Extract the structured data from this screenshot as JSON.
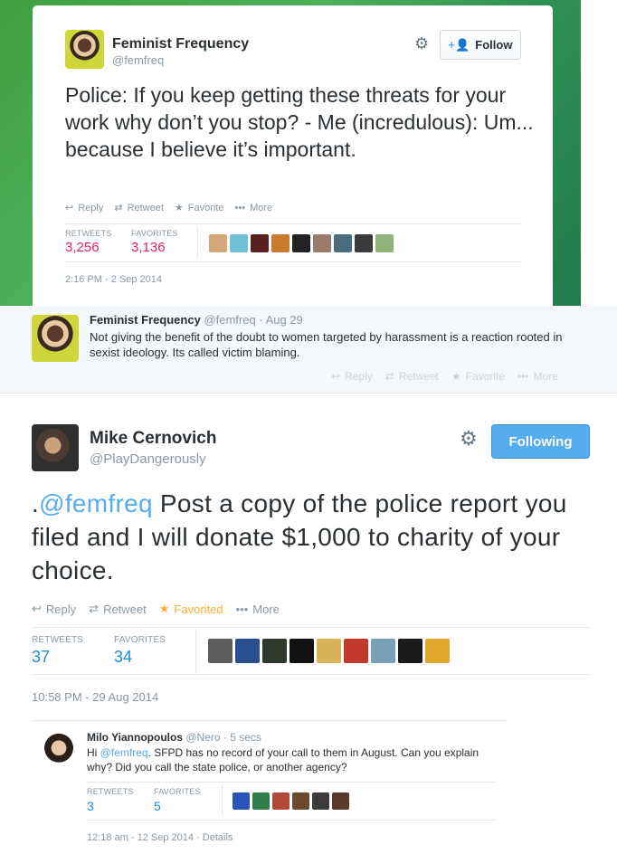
{
  "tweet1": {
    "name": "Feminist Frequency",
    "handle": "@femfreq",
    "follow_label": "Follow",
    "text": "Police: If you keep getting these threats for your work why don’t you stop? - Me (incredulous): Um... because I believe it’s important.",
    "actions": {
      "reply": "Reply",
      "retweet": "Retweet",
      "favorite": "Favorite",
      "more": "More"
    },
    "stats": {
      "retweets_label": "RETWEETS",
      "retweets": "3,256",
      "favorites_label": "FAVORITES",
      "favorites": "3,136"
    },
    "date": "2:16 PM - 2 Sep 2014",
    "accent": "#e0245e"
  },
  "tweet2": {
    "name": "Feminist Frequency",
    "handle": "@femfreq",
    "time": "· Aug 29",
    "text": "Not giving the benefit of the doubt to women targeted by harassment is a reaction rooted in sexist ideology. Its called victim blaming.",
    "actions": {
      "reply": "Reply",
      "retweet": "Retweet",
      "favorite": "Favorite",
      "more": "More"
    }
  },
  "tweet3": {
    "name": "Mike Cernovich",
    "handle": "@PlayDangerously",
    "following_label": "Following",
    "text_prefix": ".",
    "mention": "@femfreq",
    "text": " Post a copy of the police report you filed and I will donate $1,000 to charity of your choice.",
    "actions": {
      "reply": "Reply",
      "retweet": "Retweet",
      "favorite": "Favorited",
      "more": "More"
    },
    "stats": {
      "retweets_label": "RETWEETS",
      "retweets": "37",
      "favorites_label": "FAVORITES",
      "favorites": "34"
    },
    "date": "10:58 PM - 29 Aug 2014",
    "accent": "#55acee"
  },
  "reply": {
    "name": "Milo Yiannopoulos",
    "handle": "@Nero",
    "time": "· 5 secs",
    "text_prefix": "Hi ",
    "mention": "@femfreq",
    "text": ". SFPD has no record of your call to them in August. Can you explain why? Did you call the state police, or another agency?",
    "stats": {
      "retweets_label": "RETWEETS",
      "retweets": "3",
      "favorites_label": "FAVORITES",
      "favorites": "5"
    },
    "date": "12:18 am - 12 Sep 2014 · Details"
  }
}
